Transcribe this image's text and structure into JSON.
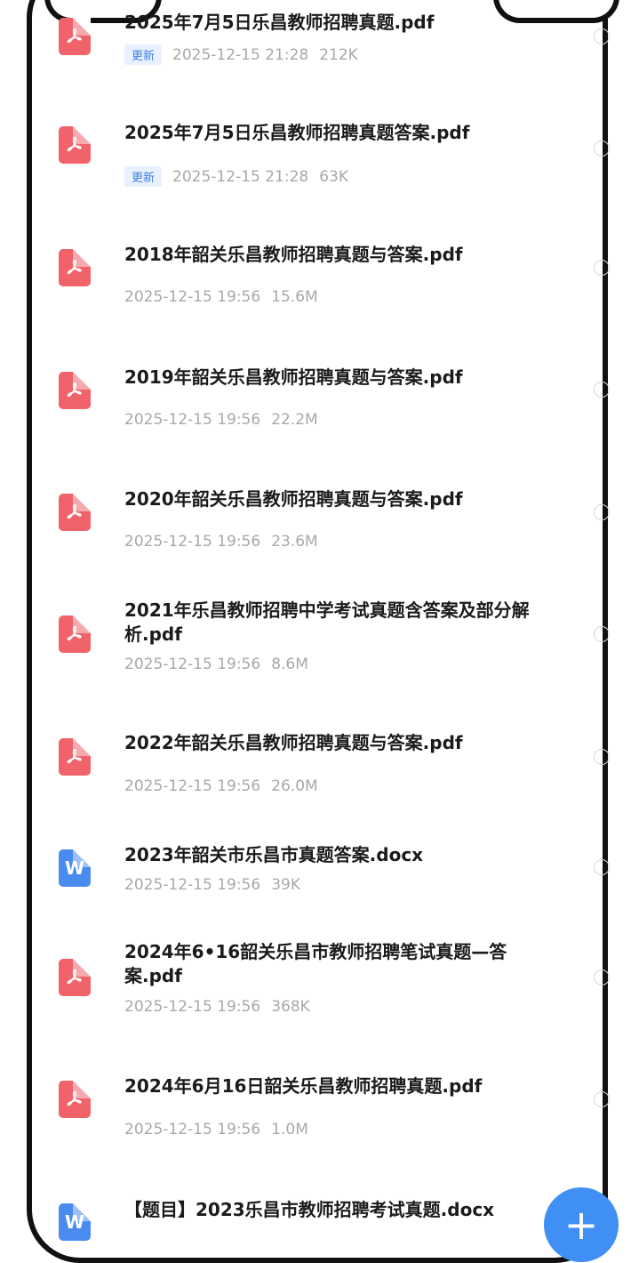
{
  "badge_label": "更新",
  "files": [
    {
      "type": "pdf",
      "name": "2025年7月5日乐昌教师招聘真题.pdf",
      "badge": true,
      "date": "2025-12-15 21:28",
      "size": "212K"
    },
    {
      "type": "pdf",
      "name": "2025年7月5日乐昌教师招聘真题答案.pdf",
      "badge": true,
      "date": "2025-12-15 21:28",
      "size": "63K"
    },
    {
      "type": "pdf",
      "name": "2018年韶关乐昌教师招聘真题与答案.pdf",
      "badge": false,
      "date": "2025-12-15 19:56",
      "size": "15.6M"
    },
    {
      "type": "pdf",
      "name": "2019年韶关乐昌教师招聘真题与答案.pdf",
      "badge": false,
      "date": "2025-12-15 19:56",
      "size": "22.2M"
    },
    {
      "type": "pdf",
      "name": "2020年韶关乐昌教师招聘真题与答案.pdf",
      "badge": false,
      "date": "2025-12-15 19:56",
      "size": "23.6M"
    },
    {
      "type": "pdf",
      "name": "2021年乐昌教师招聘中学考试真题含答案及部分解析.pdf",
      "badge": false,
      "date": "2025-12-15 19:56",
      "size": "8.6M"
    },
    {
      "type": "pdf",
      "name": "2022年韶关乐昌教师招聘真题与答案.pdf",
      "badge": false,
      "date": "2025-12-15 19:56",
      "size": "26.0M"
    },
    {
      "type": "doc",
      "name": "2023年韶关市乐昌市真题答案.docx",
      "badge": false,
      "date": "2025-12-15 19:56",
      "size": "39K"
    },
    {
      "type": "pdf",
      "name": "2024年6•16韶关乐昌市教师招聘笔试真题—答案.pdf",
      "badge": false,
      "date": "2025-12-15 19:56",
      "size": "368K"
    },
    {
      "type": "pdf",
      "name": "2024年6月16日韶关乐昌教师招聘真题.pdf",
      "badge": false,
      "date": "2025-12-15 19:56",
      "size": "1.0M"
    },
    {
      "type": "doc",
      "name": "【题目】2023乐昌市教师招聘考试真题.docx",
      "badge": false,
      "date": "",
      "size": ""
    }
  ],
  "fab_label": "+"
}
